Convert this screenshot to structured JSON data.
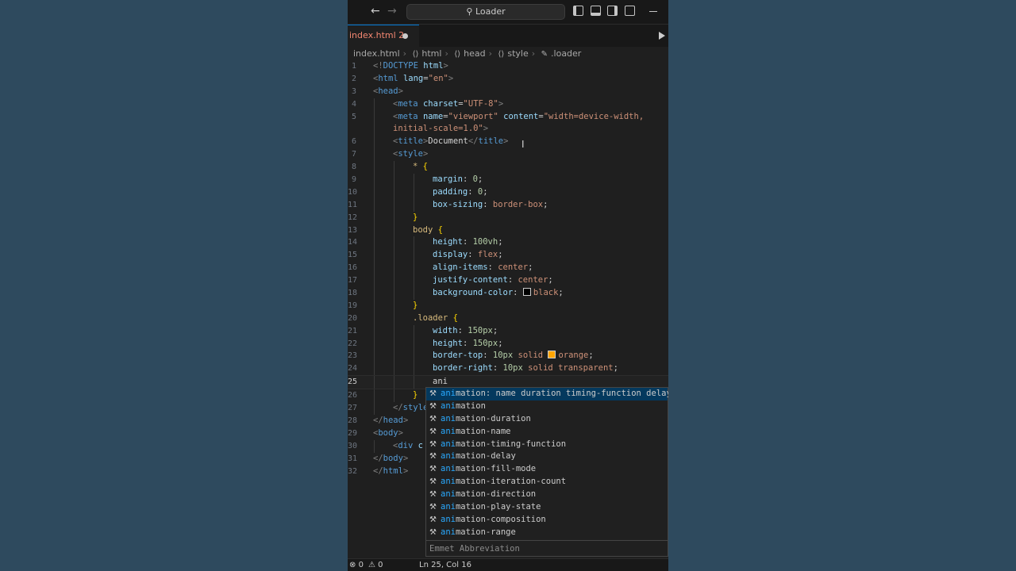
{
  "titlebar": {
    "back_icon": "←",
    "forward_icon": "→",
    "search_icon": "⚲",
    "search_label": "Loader"
  },
  "tab": {
    "label": "index.html 2",
    "run_icon": "run-icon"
  },
  "breadcrumb": [
    "index.html",
    "html",
    "head",
    "style",
    ".loader"
  ],
  "status": {
    "errors": "0",
    "warnings": "0",
    "position": "Ln 25, Col 16"
  },
  "editor": {
    "current_line": "25",
    "lines": [
      {
        "n": "1",
        "indent": 0,
        "parts": [
          [
            "t-br",
            "<!"
          ],
          [
            "t-tag",
            "DOCTYPE"
          ],
          [
            "t-txt",
            " "
          ],
          [
            "t-attr",
            "html"
          ],
          [
            "t-br",
            ">"
          ]
        ]
      },
      {
        "n": "2",
        "indent": 0,
        "parts": [
          [
            "t-br",
            "<"
          ],
          [
            "t-tag",
            "html"
          ],
          [
            "t-txt",
            " "
          ],
          [
            "t-attr",
            "lang"
          ],
          [
            "t-punc",
            "="
          ],
          [
            "t-str",
            "\"en\""
          ],
          [
            "t-br",
            ">"
          ]
        ]
      },
      {
        "n": "3",
        "indent": 0,
        "parts": [
          [
            "t-br",
            "<"
          ],
          [
            "t-tag",
            "head"
          ],
          [
            "t-br",
            ">"
          ]
        ]
      },
      {
        "n": "4",
        "indent": 1,
        "parts": [
          [
            "t-br",
            "<"
          ],
          [
            "t-tag",
            "meta"
          ],
          [
            "t-txt",
            " "
          ],
          [
            "t-attr",
            "charset"
          ],
          [
            "t-punc",
            "="
          ],
          [
            "t-str",
            "\"UTF-8\""
          ],
          [
            "t-br",
            ">"
          ]
        ]
      },
      {
        "n": "5",
        "indent": 1,
        "parts": [
          [
            "t-br",
            "<"
          ],
          [
            "t-tag",
            "meta"
          ],
          [
            "t-txt",
            " "
          ],
          [
            "t-attr",
            "name"
          ],
          [
            "t-punc",
            "="
          ],
          [
            "t-str",
            "\"viewport\""
          ],
          [
            "t-txt",
            " "
          ],
          [
            "t-attr",
            "content"
          ],
          [
            "t-punc",
            "="
          ],
          [
            "t-str",
            "\"width=device-width,"
          ]
        ]
      },
      {
        "n": "",
        "indent": 1,
        "parts": [
          [
            "t-str",
            "initial-scale=1.0\""
          ],
          [
            "t-br",
            ">"
          ]
        ]
      },
      {
        "n": "6",
        "indent": 1,
        "parts": [
          [
            "t-br",
            "<"
          ],
          [
            "t-tag",
            "title"
          ],
          [
            "t-br",
            ">"
          ],
          [
            "t-txt",
            "Document"
          ],
          [
            "t-br",
            "</"
          ],
          [
            "t-tag",
            "title"
          ],
          [
            "t-br",
            ">"
          ]
        ]
      },
      {
        "n": "7",
        "indent": 1,
        "parts": [
          [
            "t-br",
            "<"
          ],
          [
            "t-tag",
            "style"
          ],
          [
            "t-br",
            ">"
          ]
        ]
      },
      {
        "n": "8",
        "indent": 2,
        "parts": [
          [
            "t-sel",
            "*"
          ],
          [
            "t-txt",
            " "
          ],
          [
            "t-brace",
            "{"
          ]
        ]
      },
      {
        "n": "9",
        "indent": 3,
        "parts": [
          [
            "t-prop",
            "margin"
          ],
          [
            "t-punc",
            ": "
          ],
          [
            "t-num",
            "0"
          ],
          [
            "t-punc",
            ";"
          ]
        ]
      },
      {
        "n": "10",
        "indent": 3,
        "parts": [
          [
            "t-prop",
            "padding"
          ],
          [
            "t-punc",
            ": "
          ],
          [
            "t-num",
            "0"
          ],
          [
            "t-punc",
            ";"
          ]
        ]
      },
      {
        "n": "11",
        "indent": 3,
        "parts": [
          [
            "t-prop",
            "box-sizing"
          ],
          [
            "t-punc",
            ": "
          ],
          [
            "t-val",
            "border-box"
          ],
          [
            "t-punc",
            ";"
          ]
        ]
      },
      {
        "n": "12",
        "indent": 2,
        "parts": [
          [
            "t-brace",
            "}"
          ]
        ]
      },
      {
        "n": "13",
        "indent": 2,
        "parts": [
          [
            "t-sel",
            "body"
          ],
          [
            "t-txt",
            " "
          ],
          [
            "t-brace",
            "{"
          ]
        ]
      },
      {
        "n": "14",
        "indent": 3,
        "parts": [
          [
            "t-prop",
            "height"
          ],
          [
            "t-punc",
            ": "
          ],
          [
            "t-num",
            "100vh"
          ],
          [
            "t-punc",
            ";"
          ]
        ]
      },
      {
        "n": "15",
        "indent": 3,
        "parts": [
          [
            "t-prop",
            "display"
          ],
          [
            "t-punc",
            ": "
          ],
          [
            "t-val",
            "flex"
          ],
          [
            "t-punc",
            ";"
          ]
        ]
      },
      {
        "n": "16",
        "indent": 3,
        "parts": [
          [
            "t-prop",
            "align-items"
          ],
          [
            "t-punc",
            ": "
          ],
          [
            "t-val",
            "center"
          ],
          [
            "t-punc",
            ";"
          ]
        ]
      },
      {
        "n": "17",
        "indent": 3,
        "parts": [
          [
            "t-prop",
            "justify-content"
          ],
          [
            "t-punc",
            ": "
          ],
          [
            "t-val",
            "center"
          ],
          [
            "t-punc",
            ";"
          ]
        ]
      },
      {
        "n": "18",
        "indent": 3,
        "parts": [
          [
            "t-prop",
            "background-color"
          ],
          [
            "t-punc",
            ": "
          ],
          [
            "swatch",
            "#000000"
          ],
          [
            "t-val",
            "black"
          ],
          [
            "t-punc",
            ";"
          ]
        ]
      },
      {
        "n": "19",
        "indent": 2,
        "parts": [
          [
            "t-brace",
            "}"
          ]
        ]
      },
      {
        "n": "20",
        "indent": 2,
        "parts": [
          [
            "t-sel",
            ".loader"
          ],
          [
            "t-txt",
            " "
          ],
          [
            "t-brace",
            "{"
          ]
        ]
      },
      {
        "n": "21",
        "indent": 3,
        "parts": [
          [
            "t-prop",
            "width"
          ],
          [
            "t-punc",
            ": "
          ],
          [
            "t-num",
            "150px"
          ],
          [
            "t-punc",
            ";"
          ]
        ]
      },
      {
        "n": "22",
        "indent": 3,
        "parts": [
          [
            "t-prop",
            "height"
          ],
          [
            "t-punc",
            ": "
          ],
          [
            "t-num",
            "150px"
          ],
          [
            "t-punc",
            ";"
          ]
        ]
      },
      {
        "n": "23",
        "indent": 3,
        "parts": [
          [
            "t-prop",
            "border-top"
          ],
          [
            "t-punc",
            ": "
          ],
          [
            "t-num",
            "10px"
          ],
          [
            "t-txt",
            " "
          ],
          [
            "t-val",
            "solid"
          ],
          [
            "t-txt",
            " "
          ],
          [
            "swatch",
            "#ffa500"
          ],
          [
            "t-val",
            "orange"
          ],
          [
            "t-punc",
            ";"
          ]
        ]
      },
      {
        "n": "24",
        "indent": 3,
        "parts": [
          [
            "t-prop",
            "border-right"
          ],
          [
            "t-punc",
            ": "
          ],
          [
            "t-num",
            "10px"
          ],
          [
            "t-txt",
            " "
          ],
          [
            "t-val",
            "solid"
          ],
          [
            "t-txt",
            " "
          ],
          [
            "t-val",
            "transparent"
          ],
          [
            "t-punc",
            ";"
          ]
        ]
      },
      {
        "n": "25",
        "indent": 3,
        "parts": [
          [
            "t-txt",
            "ani"
          ]
        ]
      },
      {
        "n": "26",
        "indent": 2,
        "parts": [
          [
            "t-brace",
            "}"
          ]
        ]
      },
      {
        "n": "27",
        "indent": 1,
        "parts": [
          [
            "t-br",
            "</"
          ],
          [
            "t-tag",
            "style"
          ]
        ]
      },
      {
        "n": "28",
        "indent": 0,
        "parts": [
          [
            "t-br",
            "</"
          ],
          [
            "t-tag",
            "head"
          ],
          [
            "t-br",
            ">"
          ]
        ]
      },
      {
        "n": "29",
        "indent": 0,
        "parts": [
          [
            "t-br",
            "<"
          ],
          [
            "t-tag",
            "body"
          ],
          [
            "t-br",
            ">"
          ]
        ]
      },
      {
        "n": "30",
        "indent": 1,
        "parts": [
          [
            "t-br",
            "<"
          ],
          [
            "t-tag",
            "div"
          ],
          [
            "t-txt",
            " "
          ],
          [
            "t-attr",
            "c"
          ]
        ]
      },
      {
        "n": "31",
        "indent": 0,
        "parts": [
          [
            "t-br",
            "</"
          ],
          [
            "t-tag",
            "body"
          ],
          [
            "t-br",
            ">"
          ]
        ]
      },
      {
        "n": "32",
        "indent": 0,
        "parts": [
          [
            "t-br",
            "</"
          ],
          [
            "t-tag",
            "html"
          ],
          [
            "t-br",
            ">"
          ]
        ]
      }
    ]
  },
  "suggest": {
    "match": "ani",
    "items": [
      {
        "rest": "mation: name duration timing-function delay",
        "selected": true
      },
      {
        "rest": "mation"
      },
      {
        "rest": "mation-duration"
      },
      {
        "rest": "mation-name"
      },
      {
        "rest": "mation-timing-function"
      },
      {
        "rest": "mation-delay"
      },
      {
        "rest": "mation-fill-mode"
      },
      {
        "rest": "mation-iteration-count"
      },
      {
        "rest": "mation-direction"
      },
      {
        "rest": "mation-play-state"
      },
      {
        "rest": "mation-composition"
      },
      {
        "rest": "mation-range"
      }
    ],
    "footer": "Emmet Abbreviation",
    "item_icon": "wrench-icon"
  }
}
